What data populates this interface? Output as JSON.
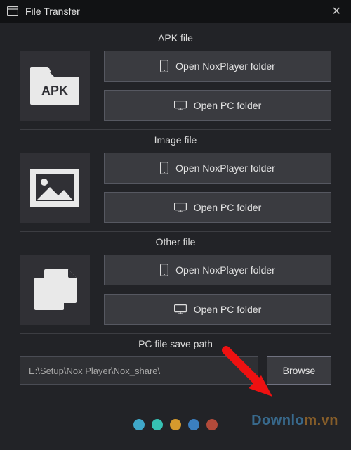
{
  "window": {
    "title": "File Transfer",
    "close_tooltip": "Close"
  },
  "sections": {
    "apk": {
      "title": "APK file",
      "nox_label": "Open NoxPlayer folder",
      "pc_label": "Open PC folder",
      "tile_text": "APK"
    },
    "image": {
      "title": "Image file",
      "nox_label": "Open NoxPlayer folder",
      "pc_label": "Open PC folder"
    },
    "other": {
      "title": "Other file",
      "nox_label": "Open NoxPlayer folder",
      "pc_label": "Open PC folder"
    }
  },
  "save_path": {
    "title": "PC file save path",
    "value": "E:\\Setup\\Nox Player\\Nox_share\\",
    "browse_label": "Browse"
  },
  "overlay": {
    "dots_colors": [
      "#3fa7c9",
      "#36c1b3",
      "#d69a2d",
      "#3b7fbf",
      "#b24a3a"
    ],
    "watermark_a": "Downlo",
    "watermark_b": "m.vn"
  }
}
